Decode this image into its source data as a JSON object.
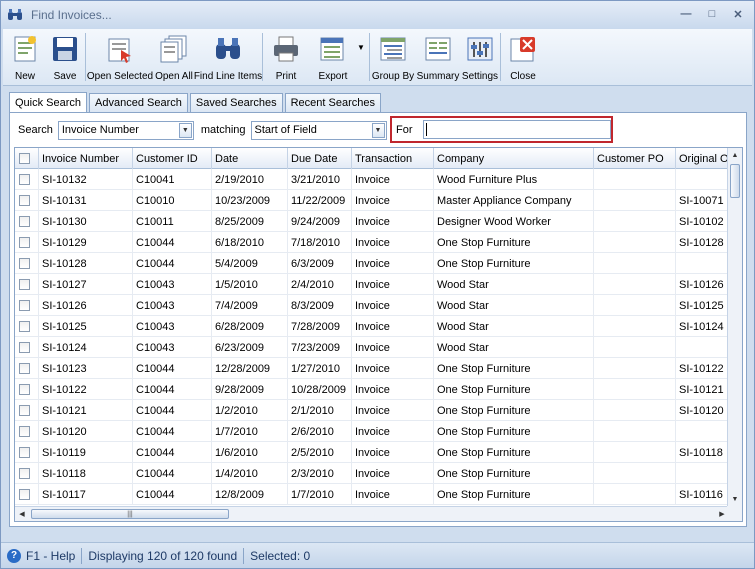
{
  "window": {
    "title": "Find Invoices..."
  },
  "toolbar": {
    "buttons": [
      {
        "label": "New",
        "icon": "new-icon"
      },
      {
        "label": "Save",
        "icon": "save-icon"
      },
      {
        "label": "Open Selected",
        "icon": "open-selected-icon"
      },
      {
        "label": "Open All",
        "icon": "open-all-icon"
      },
      {
        "label": "Find Line Items",
        "icon": "binoculars-icon"
      },
      {
        "label": "Print",
        "icon": "printer-icon"
      },
      {
        "label": "Export",
        "icon": "export-icon"
      },
      {
        "label": "Group By",
        "icon": "group-by-icon"
      },
      {
        "label": "Summary",
        "icon": "summary-icon"
      },
      {
        "label": "Settings",
        "icon": "settings-icon"
      },
      {
        "label": "Close",
        "icon": "close-icon"
      }
    ]
  },
  "tabs": [
    "Quick Search",
    "Advanced Search",
    "Saved Searches",
    "Recent Searches"
  ],
  "search": {
    "label": "Search",
    "field_value": "Invoice Number",
    "matching_label": "matching",
    "matching_value": "Start of Field",
    "for_label": "For",
    "for_value": ""
  },
  "grid": {
    "columns": [
      "Invoice Number",
      "Customer ID",
      "Date",
      "Due Date",
      "Transaction",
      "Company",
      "Customer PO",
      "Original Or"
    ],
    "rows": [
      [
        "SI-10132",
        "C10041",
        "2/19/2010",
        "3/21/2010",
        "Invoice",
        "Wood Furniture Plus",
        "",
        ""
      ],
      [
        "SI-10131",
        "C10010",
        "10/23/2009",
        "11/22/2009",
        "Invoice",
        "Master Appliance Company",
        "",
        "SI-10071"
      ],
      [
        "SI-10130",
        "C10011",
        "8/25/2009",
        "9/24/2009",
        "Invoice",
        "Designer Wood Worker",
        "",
        "SI-10102"
      ],
      [
        "SI-10129",
        "C10044",
        "6/18/2010",
        "7/18/2010",
        "Invoice",
        "One Stop Furniture",
        "",
        "SI-10128"
      ],
      [
        "SI-10128",
        "C10044",
        "5/4/2009",
        "6/3/2009",
        "Invoice",
        "One Stop Furniture",
        "",
        ""
      ],
      [
        "SI-10127",
        "C10043",
        "1/5/2010",
        "2/4/2010",
        "Invoice",
        "Wood Star",
        "",
        "SI-10126"
      ],
      [
        "SI-10126",
        "C10043",
        "7/4/2009",
        "8/3/2009",
        "Invoice",
        "Wood Star",
        "",
        "SI-10125"
      ],
      [
        "SI-10125",
        "C10043",
        "6/28/2009",
        "7/28/2009",
        "Invoice",
        "Wood Star",
        "",
        "SI-10124"
      ],
      [
        "SI-10124",
        "C10043",
        "6/23/2009",
        "7/23/2009",
        "Invoice",
        "Wood Star",
        "",
        ""
      ],
      [
        "SI-10123",
        "C10044",
        "12/28/2009",
        "1/27/2010",
        "Invoice",
        "One Stop Furniture",
        "",
        "SI-10122"
      ],
      [
        "SI-10122",
        "C10044",
        "9/28/2009",
        "10/28/2009",
        "Invoice",
        "One Stop Furniture",
        "",
        "SI-10121"
      ],
      [
        "SI-10121",
        "C10044",
        "1/2/2010",
        "2/1/2010",
        "Invoice",
        "One Stop Furniture",
        "",
        "SI-10120"
      ],
      [
        "SI-10120",
        "C10044",
        "1/7/2010",
        "2/6/2010",
        "Invoice",
        "One Stop Furniture",
        "",
        ""
      ],
      [
        "SI-10119",
        "C10044",
        "1/6/2010",
        "2/5/2010",
        "Invoice",
        "One Stop Furniture",
        "",
        "SI-10118"
      ],
      [
        "SI-10118",
        "C10044",
        "1/4/2010",
        "2/3/2010",
        "Invoice",
        "One Stop Furniture",
        "",
        ""
      ],
      [
        "SI-10117",
        "C10044",
        "12/8/2009",
        "1/7/2010",
        "Invoice",
        "One Stop Furniture",
        "",
        "SI-10116"
      ]
    ]
  },
  "status": {
    "help": "F1 - Help",
    "displaying": "Displaying 120 of 120 found",
    "selected": "Selected: 0"
  }
}
